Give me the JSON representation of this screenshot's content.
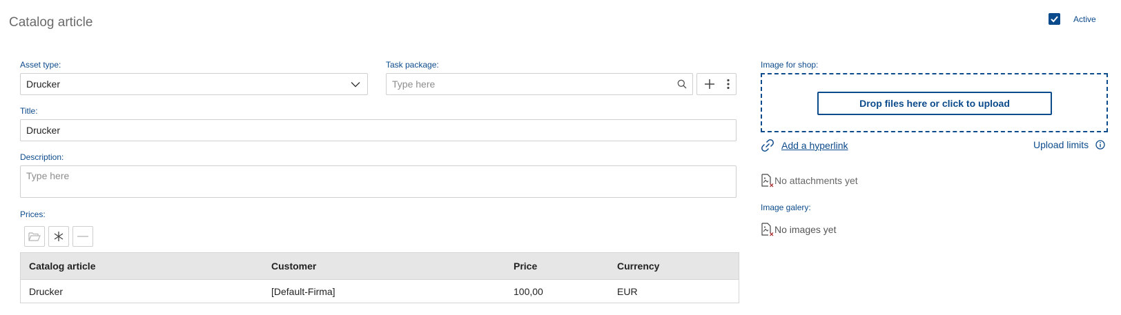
{
  "header": {
    "title": "Catalog article",
    "active_label": "Active",
    "active_checked": true
  },
  "form": {
    "asset_type": {
      "label": "Asset type:",
      "value": "Drucker"
    },
    "task_package": {
      "label": "Task package:",
      "placeholder": "Type here"
    },
    "title": {
      "label": "Title:",
      "value": "Drucker"
    },
    "description": {
      "label": "Description:",
      "placeholder": "Type here"
    }
  },
  "prices": {
    "label": "Prices:",
    "columns": [
      "Catalog article",
      "Customer",
      "Price",
      "Currency"
    ],
    "rows": [
      [
        "Drucker",
        "[Default-Firma]",
        "100,00",
        "EUR"
      ]
    ]
  },
  "shop_image": {
    "label": "Image for shop:",
    "upload_button": "Drop files here or click to upload",
    "hyperlink_label": "Add a hyperlink",
    "upload_limits_label": "Upload limits",
    "no_attachments": "No attachments yet"
  },
  "gallery": {
    "label": "Image galery:",
    "no_images": "No images yet"
  },
  "colors": {
    "accent": "#0b4a8b",
    "border": "#cfcfcf",
    "header_bg": "#e6e6e6"
  }
}
